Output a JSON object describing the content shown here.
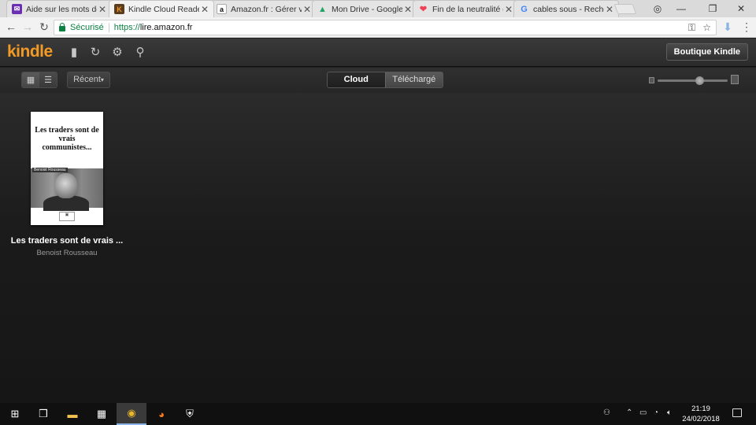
{
  "browser": {
    "tabs": [
      {
        "title": "Aide sur les mots de",
        "icon": "yahoo-mail-icon",
        "color": "#6b2fb3",
        "glyph": "✉"
      },
      {
        "title": "Kindle Cloud Reader",
        "icon": "kindle-icon",
        "color": "#5a3d1e",
        "glyph": "K"
      },
      {
        "title": "Amazon.fr : Gérer vo",
        "icon": "amazon-icon",
        "color": "#ffffff",
        "glyph": "a"
      },
      {
        "title": "Mon Drive - Google",
        "icon": "google-drive-icon",
        "color": "#1fa463",
        "glyph": "▲"
      },
      {
        "title": "Fin de la neutralité d",
        "icon": "pocket-icon",
        "color": "#ef4056",
        "glyph": "❤"
      },
      {
        "title": "cables sous - Reche",
        "icon": "google-icon",
        "color": "#ffffff",
        "glyph": "G"
      }
    ],
    "active_tab_index": 1,
    "secure_label": "Sécurisé",
    "url_scheme": "https://",
    "url_host": "lire.amazon.fr"
  },
  "kindle": {
    "logo": "kindle",
    "store_button": "Boutique Kindle",
    "sort_label": "Récent",
    "segments": {
      "cloud": "Cloud",
      "downloaded": "Téléchargé"
    },
    "selected_segment": "cloud",
    "cover_size_level": 0.6,
    "books": [
      {
        "title": "Les traders sont de vrais ...",
        "author": "Benoist Rousseau",
        "cover_title": "Les traders sont de vrais communistes...",
        "cover_author": "Benoist Rousseau"
      }
    ]
  },
  "taskbar": {
    "time": "21:19",
    "date": "24/02/2018"
  }
}
